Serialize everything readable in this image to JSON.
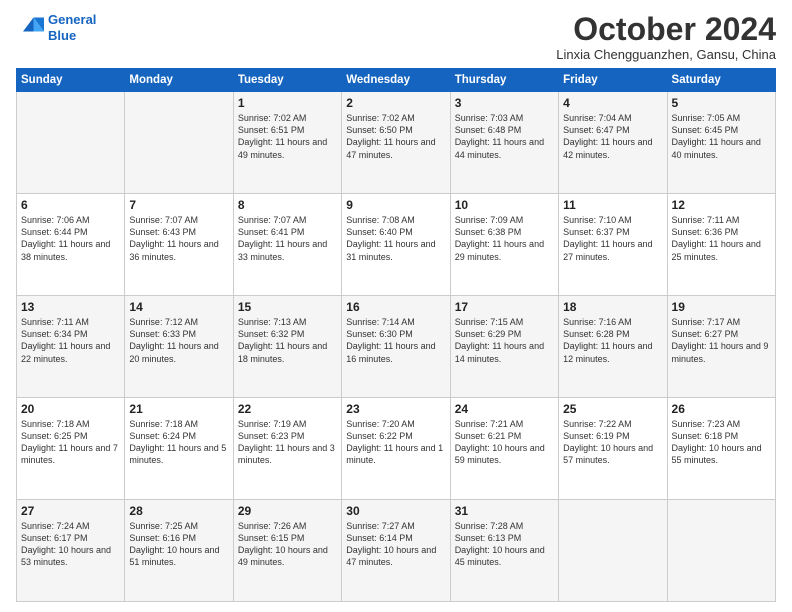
{
  "logo": {
    "line1": "General",
    "line2": "Blue"
  },
  "header": {
    "month": "October 2024",
    "location": "Linxia Chengguanzhen, Gansu, China"
  },
  "weekdays": [
    "Sunday",
    "Monday",
    "Tuesday",
    "Wednesday",
    "Thursday",
    "Friday",
    "Saturday"
  ],
  "weeks": [
    [
      {
        "day": "",
        "text": ""
      },
      {
        "day": "",
        "text": ""
      },
      {
        "day": "1",
        "text": "Sunrise: 7:02 AM\nSunset: 6:51 PM\nDaylight: 11 hours and 49 minutes."
      },
      {
        "day": "2",
        "text": "Sunrise: 7:02 AM\nSunset: 6:50 PM\nDaylight: 11 hours and 47 minutes."
      },
      {
        "day": "3",
        "text": "Sunrise: 7:03 AM\nSunset: 6:48 PM\nDaylight: 11 hours and 44 minutes."
      },
      {
        "day": "4",
        "text": "Sunrise: 7:04 AM\nSunset: 6:47 PM\nDaylight: 11 hours and 42 minutes."
      },
      {
        "day": "5",
        "text": "Sunrise: 7:05 AM\nSunset: 6:45 PM\nDaylight: 11 hours and 40 minutes."
      }
    ],
    [
      {
        "day": "6",
        "text": "Sunrise: 7:06 AM\nSunset: 6:44 PM\nDaylight: 11 hours and 38 minutes."
      },
      {
        "day": "7",
        "text": "Sunrise: 7:07 AM\nSunset: 6:43 PM\nDaylight: 11 hours and 36 minutes."
      },
      {
        "day": "8",
        "text": "Sunrise: 7:07 AM\nSunset: 6:41 PM\nDaylight: 11 hours and 33 minutes."
      },
      {
        "day": "9",
        "text": "Sunrise: 7:08 AM\nSunset: 6:40 PM\nDaylight: 11 hours and 31 minutes."
      },
      {
        "day": "10",
        "text": "Sunrise: 7:09 AM\nSunset: 6:38 PM\nDaylight: 11 hours and 29 minutes."
      },
      {
        "day": "11",
        "text": "Sunrise: 7:10 AM\nSunset: 6:37 PM\nDaylight: 11 hours and 27 minutes."
      },
      {
        "day": "12",
        "text": "Sunrise: 7:11 AM\nSunset: 6:36 PM\nDaylight: 11 hours and 25 minutes."
      }
    ],
    [
      {
        "day": "13",
        "text": "Sunrise: 7:11 AM\nSunset: 6:34 PM\nDaylight: 11 hours and 22 minutes."
      },
      {
        "day": "14",
        "text": "Sunrise: 7:12 AM\nSunset: 6:33 PM\nDaylight: 11 hours and 20 minutes."
      },
      {
        "day": "15",
        "text": "Sunrise: 7:13 AM\nSunset: 6:32 PM\nDaylight: 11 hours and 18 minutes."
      },
      {
        "day": "16",
        "text": "Sunrise: 7:14 AM\nSunset: 6:30 PM\nDaylight: 11 hours and 16 minutes."
      },
      {
        "day": "17",
        "text": "Sunrise: 7:15 AM\nSunset: 6:29 PM\nDaylight: 11 hours and 14 minutes."
      },
      {
        "day": "18",
        "text": "Sunrise: 7:16 AM\nSunset: 6:28 PM\nDaylight: 11 hours and 12 minutes."
      },
      {
        "day": "19",
        "text": "Sunrise: 7:17 AM\nSunset: 6:27 PM\nDaylight: 11 hours and 9 minutes."
      }
    ],
    [
      {
        "day": "20",
        "text": "Sunrise: 7:18 AM\nSunset: 6:25 PM\nDaylight: 11 hours and 7 minutes."
      },
      {
        "day": "21",
        "text": "Sunrise: 7:18 AM\nSunset: 6:24 PM\nDaylight: 11 hours and 5 minutes."
      },
      {
        "day": "22",
        "text": "Sunrise: 7:19 AM\nSunset: 6:23 PM\nDaylight: 11 hours and 3 minutes."
      },
      {
        "day": "23",
        "text": "Sunrise: 7:20 AM\nSunset: 6:22 PM\nDaylight: 11 hours and 1 minute."
      },
      {
        "day": "24",
        "text": "Sunrise: 7:21 AM\nSunset: 6:21 PM\nDaylight: 10 hours and 59 minutes."
      },
      {
        "day": "25",
        "text": "Sunrise: 7:22 AM\nSunset: 6:19 PM\nDaylight: 10 hours and 57 minutes."
      },
      {
        "day": "26",
        "text": "Sunrise: 7:23 AM\nSunset: 6:18 PM\nDaylight: 10 hours and 55 minutes."
      }
    ],
    [
      {
        "day": "27",
        "text": "Sunrise: 7:24 AM\nSunset: 6:17 PM\nDaylight: 10 hours and 53 minutes."
      },
      {
        "day": "28",
        "text": "Sunrise: 7:25 AM\nSunset: 6:16 PM\nDaylight: 10 hours and 51 minutes."
      },
      {
        "day": "29",
        "text": "Sunrise: 7:26 AM\nSunset: 6:15 PM\nDaylight: 10 hours and 49 minutes."
      },
      {
        "day": "30",
        "text": "Sunrise: 7:27 AM\nSunset: 6:14 PM\nDaylight: 10 hours and 47 minutes."
      },
      {
        "day": "31",
        "text": "Sunrise: 7:28 AM\nSunset: 6:13 PM\nDaylight: 10 hours and 45 minutes."
      },
      {
        "day": "",
        "text": ""
      },
      {
        "day": "",
        "text": ""
      }
    ]
  ]
}
